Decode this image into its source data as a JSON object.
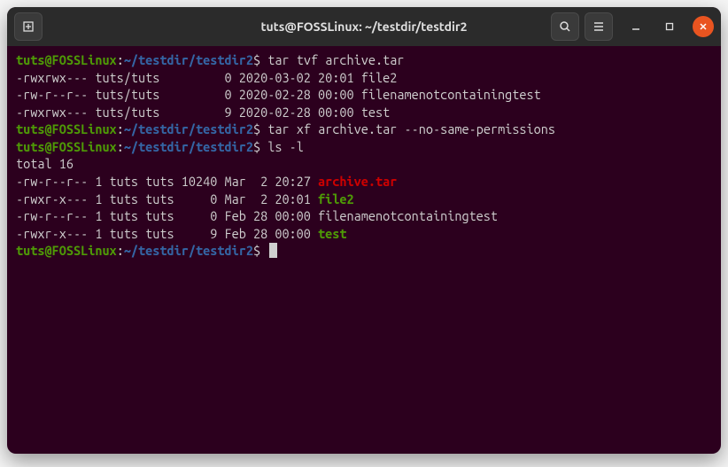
{
  "titlebar": {
    "title": "tuts@FOSSLinux: ~/testdir/testdir2"
  },
  "prompt": {
    "user": "tuts@FOSSLinux",
    "colon": ":",
    "path": "~/testdir/testdir2",
    "dollar": "$"
  },
  "commands": {
    "cmd1": "tar tvf archive.tar",
    "cmd2": "tar xf archive.tar --no-same-permissions",
    "cmd3": "ls -l"
  },
  "output": {
    "tvf1": "-rwxrwx--- tuts/tuts         0 2020-03-02 20:01 file2",
    "tvf2": "-rw-r--r-- tuts/tuts         0 2020-02-28 00:00 filenamenotcontainingtest",
    "tvf3": "-rwxrwx--- tuts/tuts         9 2020-02-28 00:00 test",
    "total": "total 16",
    "ls1_pre": "-rw-r--r-- 1 tuts tuts 10240 Mar  2 20:27 ",
    "ls1_file": "archive.tar",
    "ls2_pre": "-rwxr-x--- 1 tuts tuts     0 Mar  2 20:01 ",
    "ls2_file": "file2",
    "ls3_pre": "-rw-r--r-- 1 tuts tuts     0 Feb 28 00:00 ",
    "ls3_file": "filenamenotcontainingtest",
    "ls4_pre": "-rwxr-x--- 1 tuts tuts     9 Feb 28 00:00 ",
    "ls4_file": "test"
  }
}
